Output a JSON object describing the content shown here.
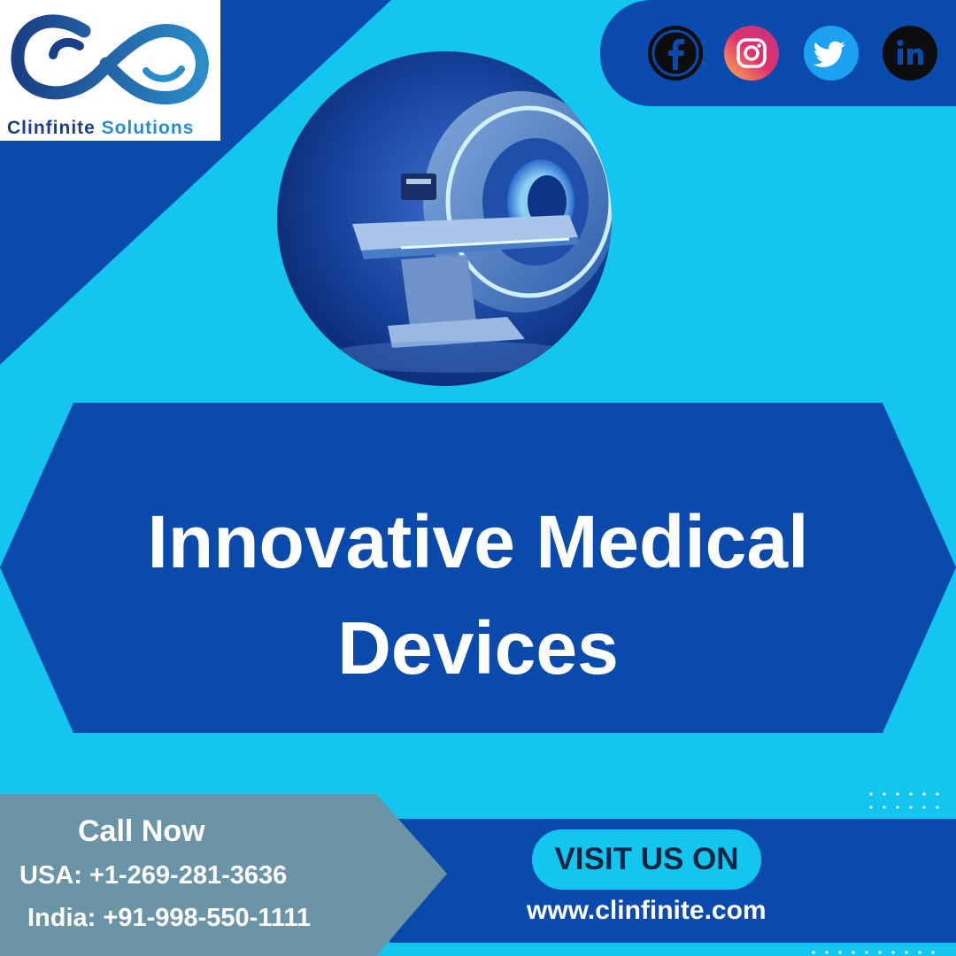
{
  "brand": {
    "name_part1": "Clinfinite",
    "name_part2": "Solutions",
    "primary_color": "#0a4aad",
    "accent_color": "#12c6ef"
  },
  "social": [
    {
      "name": "facebook-icon",
      "bg": "#0d0d0d",
      "ring": "#0d0d0d"
    },
    {
      "name": "instagram-icon",
      "bg": "#e1306c"
    },
    {
      "name": "twitter-icon",
      "bg": "#1da1f2"
    },
    {
      "name": "linkedin-icon",
      "bg": "#0d0d0d"
    }
  ],
  "headline": {
    "line1": "Innovative Medical",
    "line2": "Devices"
  },
  "contact": {
    "title": "Call Now",
    "usa": "USA: +1-269-281-3636",
    "india": "India: +91-998-550-1111"
  },
  "visit": {
    "label": "VISIT US ON",
    "website": "www.clinfinite.com"
  }
}
